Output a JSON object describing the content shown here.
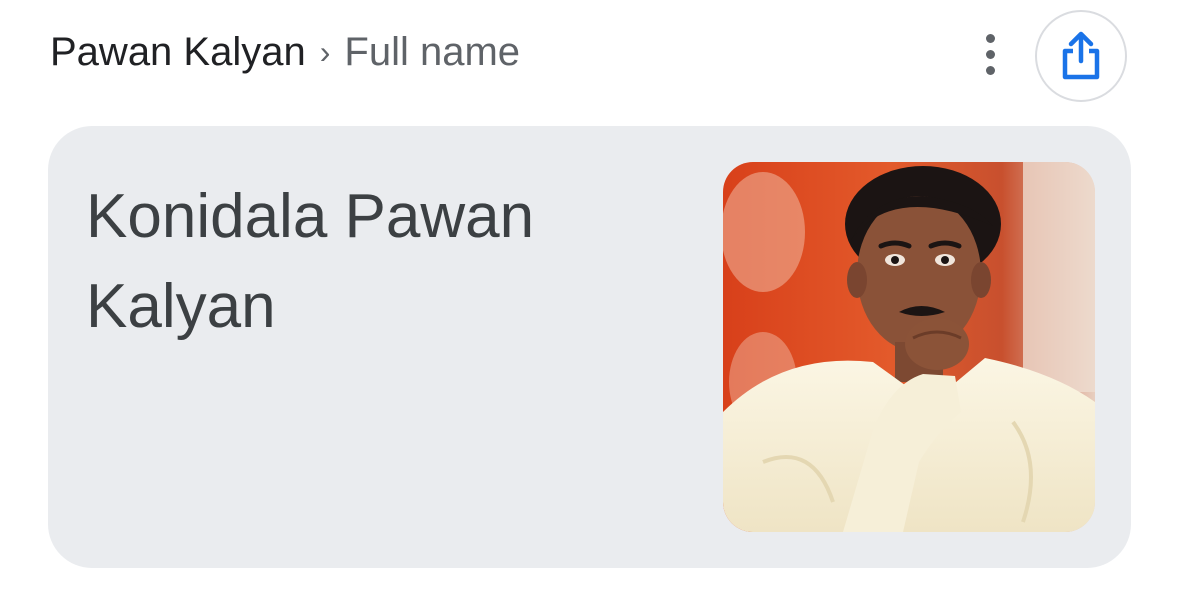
{
  "header": {
    "breadcrumb": {
      "parent": "Pawan Kalyan",
      "separator": "›",
      "current": "Full name"
    },
    "more_icon": "more-vert-icon",
    "share_icon": "share-icon"
  },
  "card": {
    "answer": "Konidala Pawan Kalyan",
    "image_subject": "portrait-photo"
  },
  "colors": {
    "card_background": "#eaecef",
    "share_accent": "#1a73e8",
    "text_primary": "#202124",
    "text_secondary": "#5f6368"
  }
}
